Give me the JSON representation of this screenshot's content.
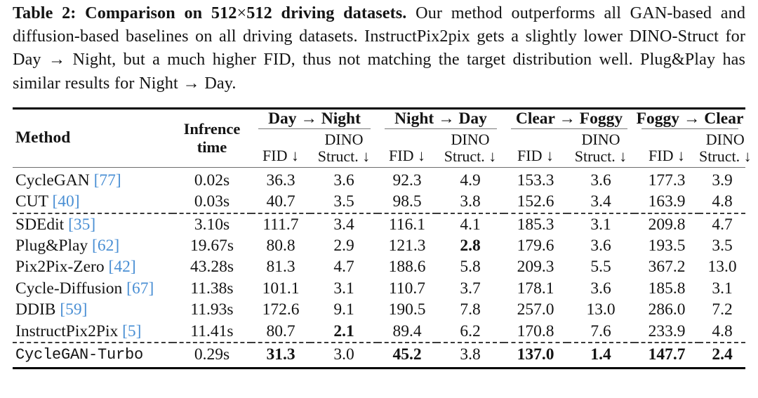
{
  "caption": {
    "label": "Table 2:",
    "bold_title": "Comparison on 512 × 512 driving datasets.",
    "bold_part1": "Comparison on",
    "bold_dim1": "512",
    "times": "×",
    "bold_dim2": "512",
    "bold_part2": "driving datasets.",
    "body": "Our method outperforms all GAN-based and diffusion-based baselines on all driving datasets. InstructPix2pix gets a slightly lower DINO-Struct for Day → Night, but a much higher FID, thus not matching the target distribution well. Plug&Play has similar results for Night → Day."
  },
  "table": {
    "col_method": "Method",
    "col_inference_line1": "Infrence",
    "col_inference_line2": "time",
    "groups": [
      {
        "name": "Day → Night"
      },
      {
        "name": "Night → Day"
      },
      {
        "name": "Clear → Foggy"
      },
      {
        "name": "Foggy → Clear"
      }
    ],
    "sub_fid": "FID ↓",
    "sub_dino_l1": "DINO",
    "sub_dino_l2": "Struct. ↓",
    "rows": [
      {
        "method": "CycleGAN",
        "cite": "[77]",
        "mono": false,
        "dashed_above": false,
        "time": "0.02s",
        "cells": [
          "36.3",
          "3.6",
          "92.3",
          "4.9",
          "153.3",
          "3.6",
          "177.3",
          "3.9"
        ],
        "bold": [
          false,
          false,
          false,
          false,
          false,
          false,
          false,
          false
        ],
        "time_bold": false
      },
      {
        "method": "CUT",
        "cite": "[40]",
        "mono": false,
        "dashed_above": false,
        "time": "0.03s",
        "cells": [
          "40.7",
          "3.5",
          "98.5",
          "3.8",
          "152.6",
          "3.4",
          "163.9",
          "4.8"
        ],
        "bold": [
          false,
          false,
          false,
          false,
          false,
          false,
          false,
          false
        ],
        "time_bold": false
      },
      {
        "method": "SDEdit",
        "cite": "[35]",
        "mono": false,
        "dashed_above": true,
        "time": "3.10s",
        "cells": [
          "111.7",
          "3.4",
          "116.1",
          "4.1",
          "185.3",
          "3.1",
          "209.8",
          "4.7"
        ],
        "bold": [
          false,
          false,
          false,
          false,
          false,
          false,
          false,
          false
        ],
        "time_bold": false
      },
      {
        "method": "Plug&Play",
        "cite": "[62]",
        "mono": false,
        "dashed_above": false,
        "time": "19.67s",
        "cells": [
          "80.8",
          "2.9",
          "121.3",
          "2.8",
          "179.6",
          "3.6",
          "193.5",
          "3.5"
        ],
        "bold": [
          false,
          false,
          false,
          true,
          false,
          false,
          false,
          false
        ],
        "time_bold": false
      },
      {
        "method": "Pix2Pix-Zero",
        "cite": "[42]",
        "mono": false,
        "dashed_above": false,
        "time": "43.28s",
        "cells": [
          "81.3",
          "4.7",
          "188.6",
          "5.8",
          "209.3",
          "5.5",
          "367.2",
          "13.0"
        ],
        "bold": [
          false,
          false,
          false,
          false,
          false,
          false,
          false,
          false
        ],
        "time_bold": false
      },
      {
        "method": "Cycle-Diffusion",
        "cite": "[67]",
        "mono": false,
        "dashed_above": false,
        "time": "11.38s",
        "cells": [
          "101.1",
          "3.1",
          "110.7",
          "3.7",
          "178.1",
          "3.6",
          "185.8",
          "3.1"
        ],
        "bold": [
          false,
          false,
          false,
          false,
          false,
          false,
          false,
          false
        ],
        "time_bold": false
      },
      {
        "method": "DDIB",
        "cite": "[59]",
        "mono": false,
        "dashed_above": false,
        "time": "11.93s",
        "cells": [
          "172.6",
          "9.1",
          "190.5",
          "7.8",
          "257.0",
          "13.0",
          "286.0",
          "7.2"
        ],
        "bold": [
          false,
          false,
          false,
          false,
          false,
          false,
          false,
          false
        ],
        "time_bold": false
      },
      {
        "method": "InstructPix2Pix",
        "cite": "[5]",
        "mono": false,
        "dashed_above": false,
        "time": "11.41s",
        "cells": [
          "80.7",
          "2.1",
          "89.4",
          "6.2",
          "170.8",
          "7.6",
          "233.9",
          "4.8"
        ],
        "bold": [
          false,
          true,
          false,
          false,
          false,
          false,
          false,
          false
        ],
        "time_bold": false
      },
      {
        "method": "CycleGAN-Turbo",
        "cite": "",
        "mono": true,
        "dashed_above": true,
        "time": "0.29s",
        "cells": [
          "31.3",
          "3.0",
          "45.2",
          "3.8",
          "137.0",
          "1.4",
          "147.7",
          "2.4"
        ],
        "bold": [
          true,
          false,
          true,
          false,
          true,
          true,
          true,
          true
        ],
        "time_bold": false
      }
    ]
  },
  "colors": {
    "citation": "#4a8fd4",
    "rule": "#000000",
    "subrule": "#787878",
    "text": "#141414"
  }
}
